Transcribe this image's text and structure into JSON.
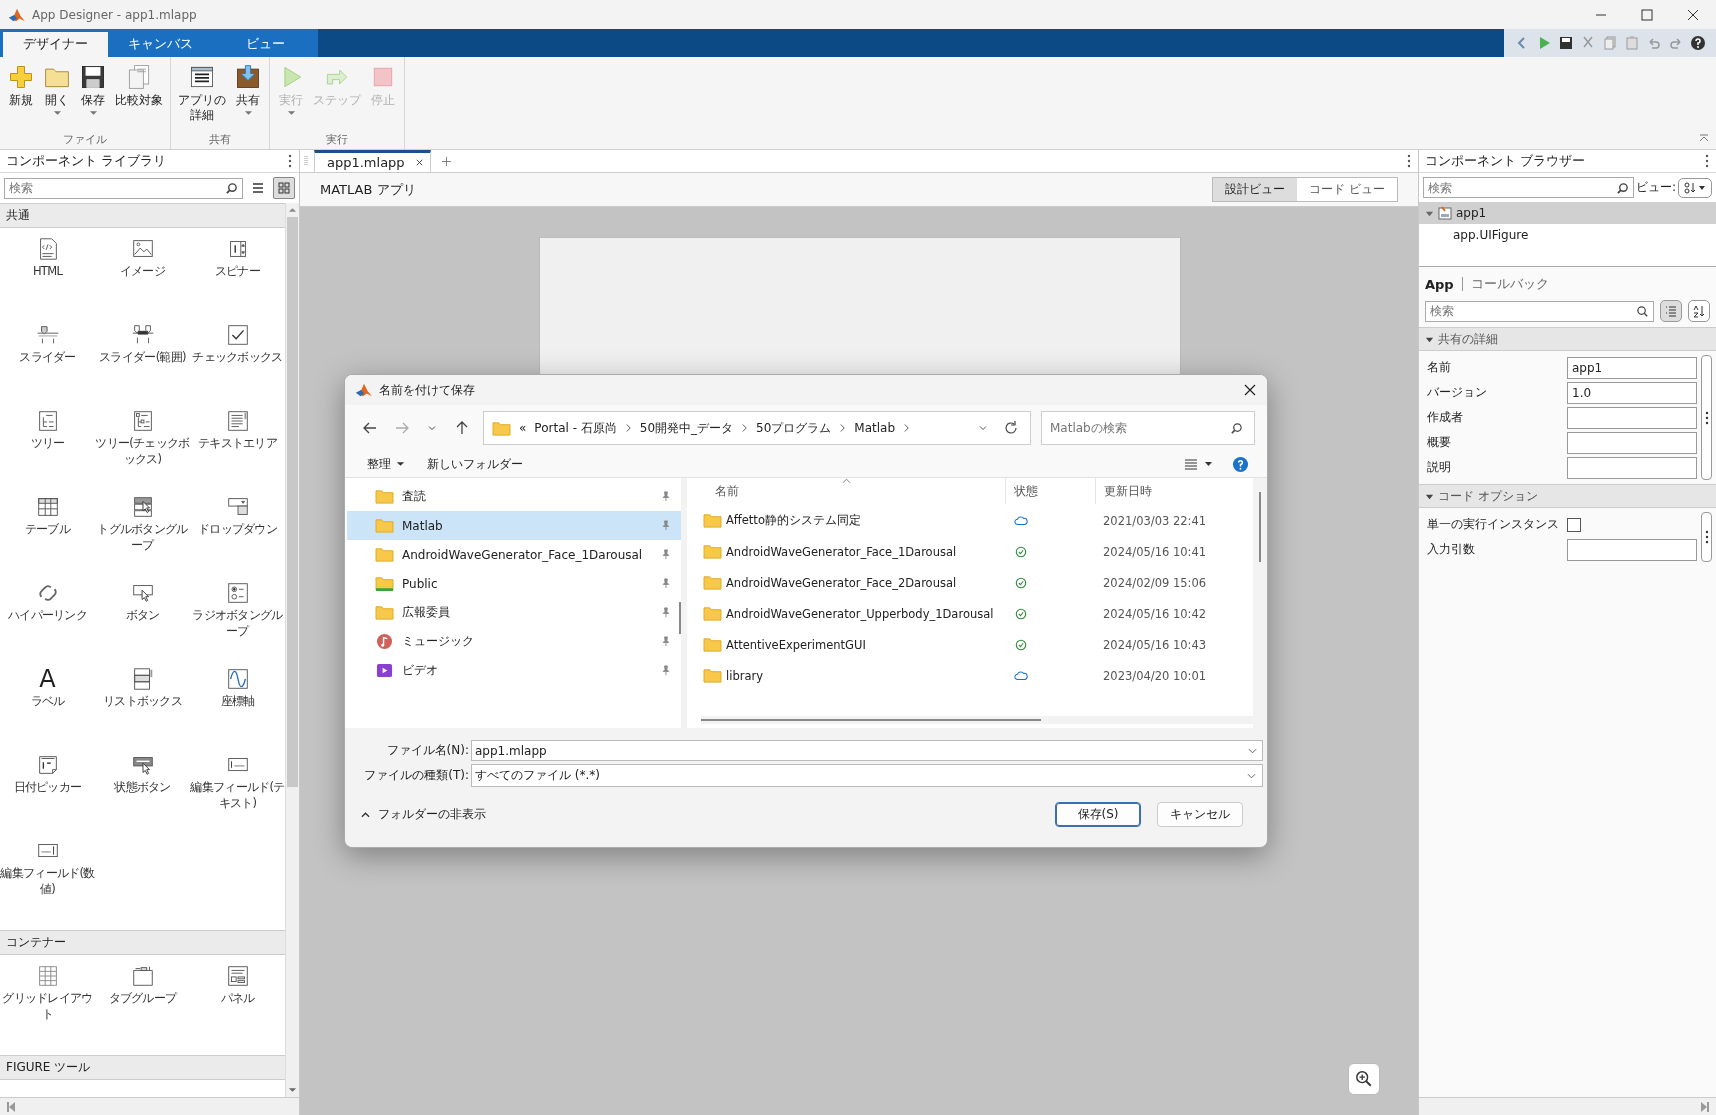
{
  "window": {
    "title": "App Designer - app1.mlapp"
  },
  "ribbon_tabs": [
    {
      "label": "デザイナー",
      "selected": true
    },
    {
      "label": "キャンバス",
      "selected": false
    },
    {
      "label": "ビュー",
      "selected": false
    }
  ],
  "ribbon_groups": [
    {
      "label": "ファイル",
      "buttons": [
        {
          "label": "新規",
          "kind": "new",
          "dropdown": false,
          "disabled": false
        },
        {
          "label": "開く",
          "kind": "open",
          "dropdown": true,
          "disabled": false
        },
        {
          "label": "保存",
          "kind": "save",
          "dropdown": true,
          "disabled": false
        },
        {
          "label": "比較対象",
          "kind": "compare",
          "dropdown": false,
          "disabled": false
        }
      ]
    },
    {
      "label": "共有",
      "buttons": [
        {
          "label": "アプリの詳細",
          "kind": "details",
          "dropdown": false,
          "disabled": false
        },
        {
          "label": "共有",
          "kind": "share",
          "dropdown": true,
          "disabled": false
        }
      ]
    },
    {
      "label": "実行",
      "buttons": [
        {
          "label": "実行",
          "kind": "run",
          "dropdown": true,
          "disabled": true
        },
        {
          "label": "ステップ",
          "kind": "step",
          "dropdown": false,
          "disabled": true
        },
        {
          "label": "停止",
          "kind": "stop",
          "dropdown": false,
          "disabled": true
        }
      ]
    }
  ],
  "library": {
    "title": "コンポーネント ライブラリ",
    "search": {
      "placeholder": "検索"
    },
    "view_buttons": [
      {
        "kind": "list",
        "selected": false
      },
      {
        "kind": "grid",
        "selected": true
      }
    ],
    "sections": [
      {
        "title": "共通",
        "items": [
          {
            "label": "HTML",
            "kind": "html"
          },
          {
            "label": "イメージ",
            "kind": "image"
          },
          {
            "label": "スピナー",
            "kind": "spinner"
          },
          {
            "label": "スライダー",
            "kind": "slider"
          },
          {
            "label": "スライダー (範囲)",
            "kind": "range-slider"
          },
          {
            "label": "チェック ボックス",
            "kind": "checkbox"
          },
          {
            "label": "ツリー",
            "kind": "tree"
          },
          {
            "label": "ツリー (チェック ボックス)",
            "kind": "checkbox-tree"
          },
          {
            "label": "テキスト エリア",
            "kind": "text-area"
          },
          {
            "label": "テーブル",
            "kind": "table"
          },
          {
            "label": "トグル ボタン グループ",
            "kind": "toggle-group"
          },
          {
            "label": "ドロップ ダウン",
            "kind": "dropdown"
          },
          {
            "label": "ハイパーリンク",
            "kind": "hyperlink"
          },
          {
            "label": "ボタン",
            "kind": "button"
          },
          {
            "label": "ラジオ ボタン グループ",
            "kind": "radio-group"
          },
          {
            "label": "ラベル",
            "kind": "label",
            "glyph": "A"
          },
          {
            "label": "リスト ボックス",
            "kind": "listbox"
          },
          {
            "label": "座標軸",
            "kind": "axes"
          },
          {
            "label": "日付ピッカー",
            "kind": "date-picker"
          },
          {
            "label": "状態ボタン",
            "kind": "state-button"
          },
          {
            "label": "編集フィールド (テキスト)",
            "kind": "edit-text"
          },
          {
            "label": "編集フィールド (数値)",
            "kind": "edit-numeric"
          }
        ]
      },
      {
        "title": "コンテナー",
        "items": [
          {
            "label": "グリッド レイアウト",
            "kind": "grid-layout"
          },
          {
            "label": "タブ グループ",
            "kind": "tab-group"
          },
          {
            "label": "パネル",
            "kind": "panel"
          }
        ]
      },
      {
        "title": "FIGURE ツール"
      }
    ]
  },
  "document": {
    "tabs": [
      {
        "label": "app1.mlapp",
        "selected": true
      }
    ],
    "title": "MATLAB アプリ",
    "views": [
      {
        "label": "設計ビュー",
        "selected": true
      },
      {
        "label": "コード ビュー",
        "selected": false
      }
    ]
  },
  "browser": {
    "title": "コンポーネント ブラウザー",
    "search": {
      "placeholder": "検索"
    },
    "view_label": "ビュー:",
    "tree": [
      {
        "label": "app1",
        "selected": true,
        "expanded": true,
        "children": [
          {
            "label": "app.UIFigure",
            "selected": false
          }
        ]
      }
    ],
    "tabs": [
      {
        "label": "App",
        "selected": true
      },
      {
        "label": "コールバック",
        "selected": false
      }
    ],
    "property_search": {
      "placeholder": "検索"
    },
    "sections": [
      {
        "title": "共有の詳細",
        "expanded": true,
        "rows": [
          {
            "label": "名前",
            "kind": "text",
            "value": "app1"
          },
          {
            "label": "バージョン",
            "kind": "text",
            "value": "1.0"
          },
          {
            "label": "作成者",
            "kind": "text"
          },
          {
            "label": "概要",
            "kind": "text"
          },
          {
            "label": "説明",
            "kind": "text"
          }
        ]
      },
      {
        "title": "コード オプション",
        "expanded": true,
        "rows": [
          {
            "label": "単一の実行インスタンス",
            "kind": "checkbox",
            "checked": false
          },
          {
            "label": "入力引数",
            "kind": "text"
          }
        ]
      }
    ]
  },
  "save_dialog": {
    "title": "名前を付けて保存",
    "address": {
      "overflow": "«",
      "crumbs": [
        "Portal - 石原尚",
        "50開発中_データ",
        "50プログラム",
        "Matlab"
      ]
    },
    "search": {
      "placeholder": "Matlabの検索"
    },
    "commands": [
      {
        "label": "整理",
        "dropdown": true
      },
      {
        "label": "新しいフォルダー",
        "dropdown": false
      }
    ],
    "nav": [
      {
        "label": "査読",
        "kind": "folder",
        "selected": false,
        "pinned": true
      },
      {
        "label": "Matlab",
        "kind": "folder",
        "selected": true,
        "pinned": true
      },
      {
        "label": "AndroidWaveGenerator_Face_1Darousal",
        "kind": "folder",
        "selected": false,
        "pinned": true
      },
      {
        "label": "Public",
        "kind": "public-folder",
        "selected": false,
        "pinned": true
      },
      {
        "label": "広報委員",
        "kind": "folder",
        "selected": false,
        "pinned": true
      },
      {
        "label": "ミュージック",
        "kind": "music",
        "selected": false,
        "pinned": true
      },
      {
        "label": "ビデオ",
        "kind": "video",
        "selected": false,
        "pinned": true
      }
    ],
    "columns": [
      "名前",
      "状態",
      "更新日時"
    ],
    "files": [
      {
        "name": "Affetto静的システム同定",
        "kind": "cloud",
        "modified": "2021/03/03 22:41"
      },
      {
        "name": "AndroidWaveGenerator_Face_1Darousal",
        "kind": "synced",
        "modified": "2024/05/16 10:41"
      },
      {
        "name": "AndroidWaveGenerator_Face_2Darousal",
        "kind": "synced",
        "modified": "2024/02/09 15:06"
      },
      {
        "name": "AndroidWaveGenerator_Upperbody_1Darousal",
        "kind": "synced",
        "modified": "2024/05/16 10:42"
      },
      {
        "name": "AttentiveExperimentGUI",
        "kind": "synced",
        "modified": "2024/05/16 10:43"
      },
      {
        "name": "library",
        "kind": "cloud",
        "modified": "2023/04/20 10:01"
      }
    ],
    "file_name": {
      "label": "ファイル名(N):",
      "value": "app1.mlapp"
    },
    "file_type": {
      "label": "ファイルの種類(T):",
      "value": "すべてのファイル (*.*)"
    },
    "folder_toggle": "フォルダーの非表示",
    "buttons": [
      {
        "label": "保存(S)",
        "primary": true
      },
      {
        "label": "キャンセル",
        "primary": false
      }
    ]
  }
}
